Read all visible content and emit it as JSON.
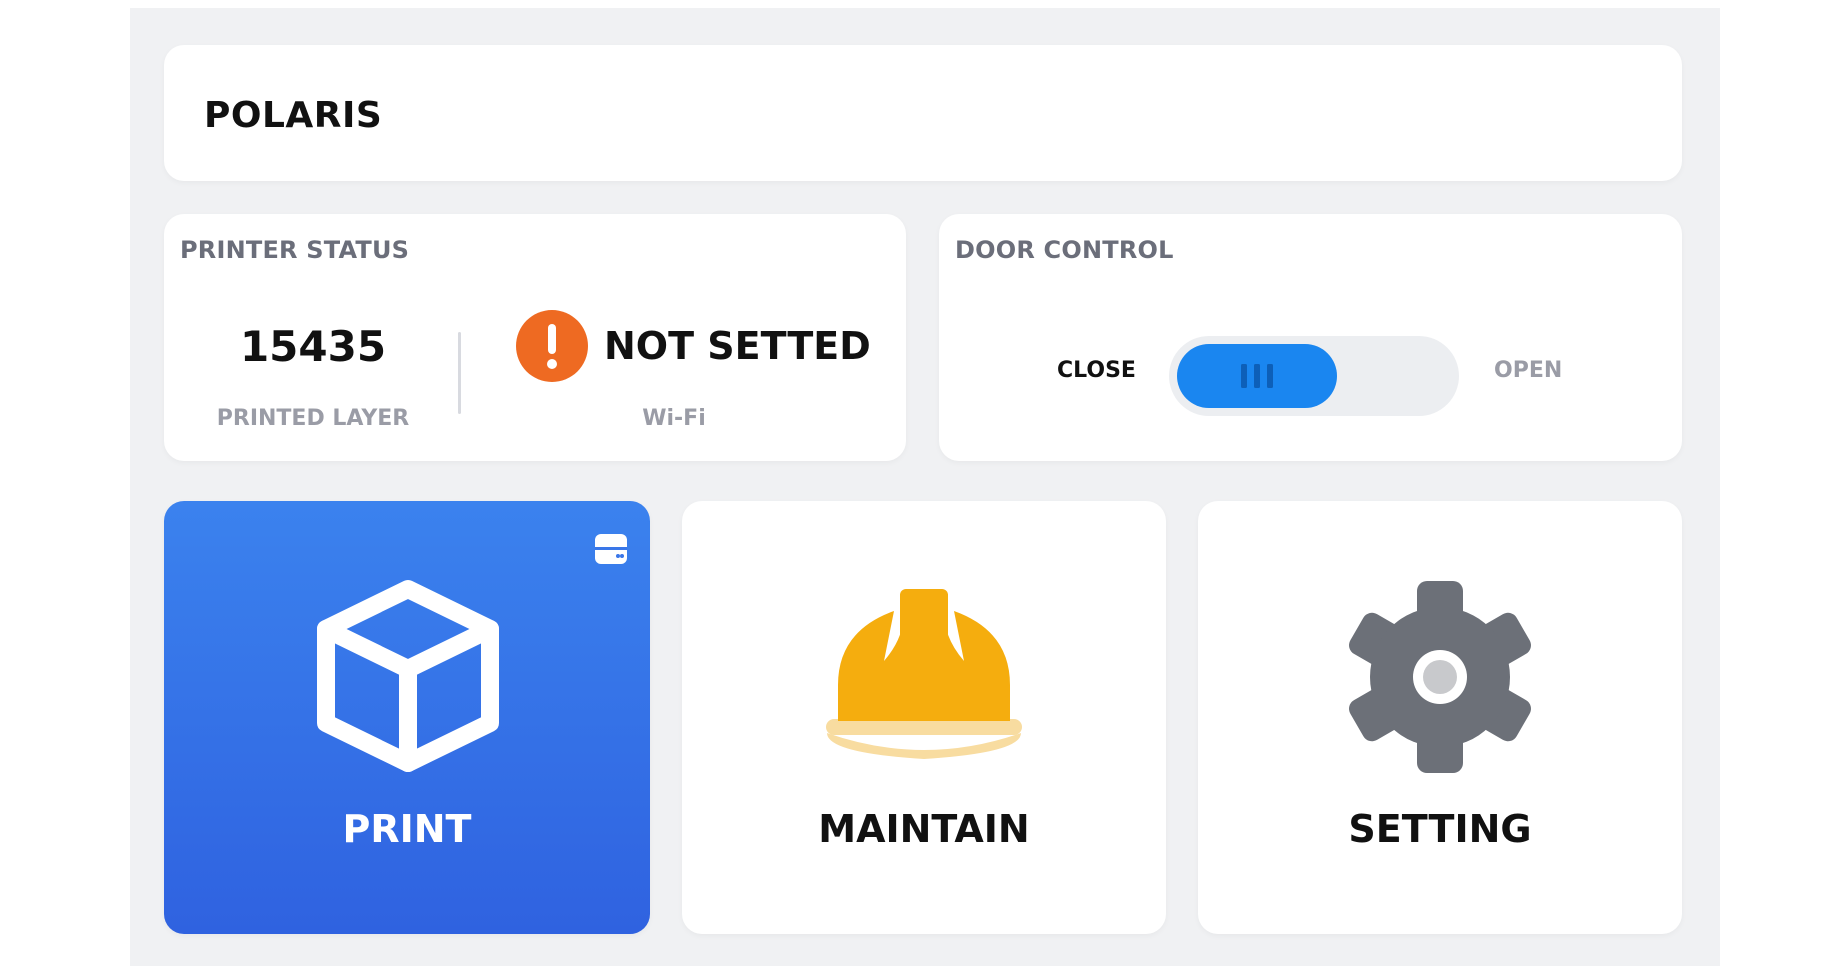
{
  "app": {
    "title": "POLARIS"
  },
  "printer_status": {
    "section_label": "PRINTER STATUS",
    "printed_layer_value": "15435",
    "printed_layer_label": "PRINTED LAYER",
    "wifi_status": "NOT SETTED",
    "wifi_label": "Wi-Fi",
    "wifi_alert_icon": "exclamation-circle-icon",
    "alert_color": "#ee6a22"
  },
  "door_control": {
    "section_label": "DOOR CONTROL",
    "close_label": "CLOSE",
    "open_label": "OPEN",
    "state": "closed",
    "toggle_color": "#1a86f0"
  },
  "tiles": [
    {
      "label": "PRINT",
      "icon": "cube-icon",
      "active": true,
      "badge_icon": "storage-icon"
    },
    {
      "label": "MAINTAIN",
      "icon": "hard-hat-icon",
      "active": false
    },
    {
      "label": "SETTING",
      "icon": "gear-icon",
      "active": false
    }
  ],
  "colors": {
    "background": "#f0f1f3",
    "print_tile": "#3272e6",
    "hard_hat": "#f5ad0e",
    "gear": "#6c7078"
  }
}
